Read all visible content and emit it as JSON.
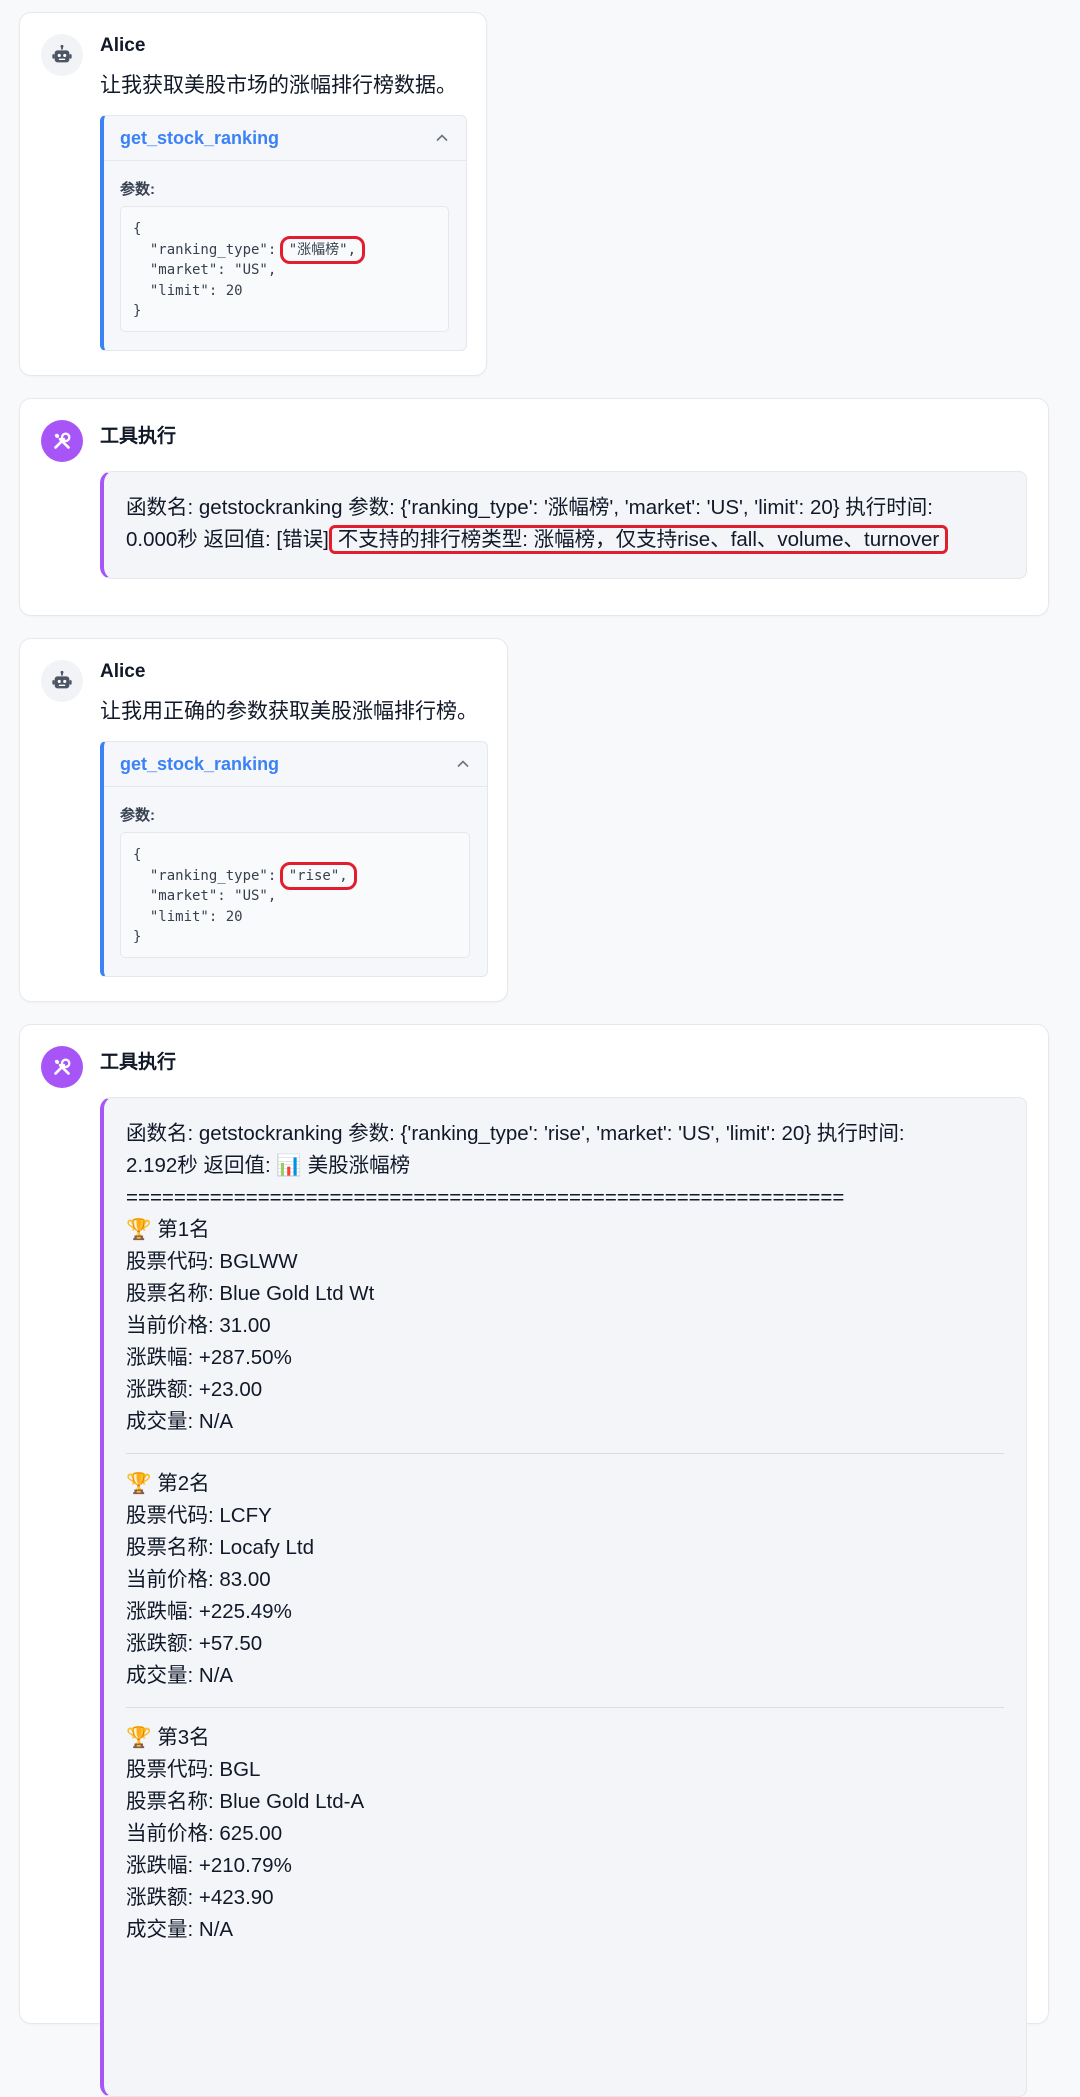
{
  "messages": [
    {
      "author": "Alice",
      "text": "让我获取美股市场的涨幅排行榜数据。",
      "call": {
        "name": "get_stock_ranking",
        "params_label": "参数:",
        "lines": [
          "{",
          "  \"ranking_type\": ",
          "  \"market\": \"US\",",
          "  \"limit\": 20",
          "}"
        ],
        "highlight": "\"涨幅榜\","
      }
    },
    {
      "author": "工具执行",
      "line1": "函数名: getstockranking 参数: {'ranking_type': '涨幅榜', 'market': 'US', 'limit': 20} 执行时间:",
      "line2_prefix": "0.000秒 返回值: [错误]",
      "error": "不支持的排行榜类型: 涨幅榜，仅支持rise、fall、volume、turnover"
    },
    {
      "author": "Alice",
      "text": "让我用正确的参数获取美股涨幅排行榜。",
      "call": {
        "name": "get_stock_ranking",
        "params_label": "参数:",
        "lines": [
          "{",
          "  \"ranking_type\": ",
          "  \"market\": \"US\",",
          "  \"limit\": 20",
          "}"
        ],
        "highlight": "\"rise\","
      }
    },
    {
      "author": "工具执行",
      "line1": "函数名: getstockranking 参数: {'ranking_type': 'rise', 'market': 'US', 'limit': 20} 执行时间:",
      "line2": "2.192秒 返回值: 📊 美股涨幅榜",
      "divider": "============================================================",
      "rankings": [
        {
          "title": "🏆 第1名",
          "code": "股票代码: BGLWW",
          "name": "股票名称: Blue Gold Ltd Wt",
          "price": "当前价格: 31.00",
          "pct": "涨跌幅: +287.50%",
          "amt": "涨跌额: +23.00",
          "vol": "成交量: N/A"
        },
        {
          "title": "🏆 第2名",
          "code": "股票代码: LCFY",
          "name": "股票名称: Locafy Ltd",
          "price": "当前价格: 83.00",
          "pct": "涨跌幅: +225.49%",
          "amt": "涨跌额: +57.50",
          "vol": "成交量: N/A"
        },
        {
          "title": "🏆 第3名",
          "code": "股票代码: BGL",
          "name": "股票名称: Blue Gold Ltd-A",
          "price": "当前价格: 625.00",
          "pct": "涨跌幅: +210.79%",
          "amt": "涨跌额: +423.90",
          "vol": "成交量: N/A"
        }
      ]
    }
  ]
}
